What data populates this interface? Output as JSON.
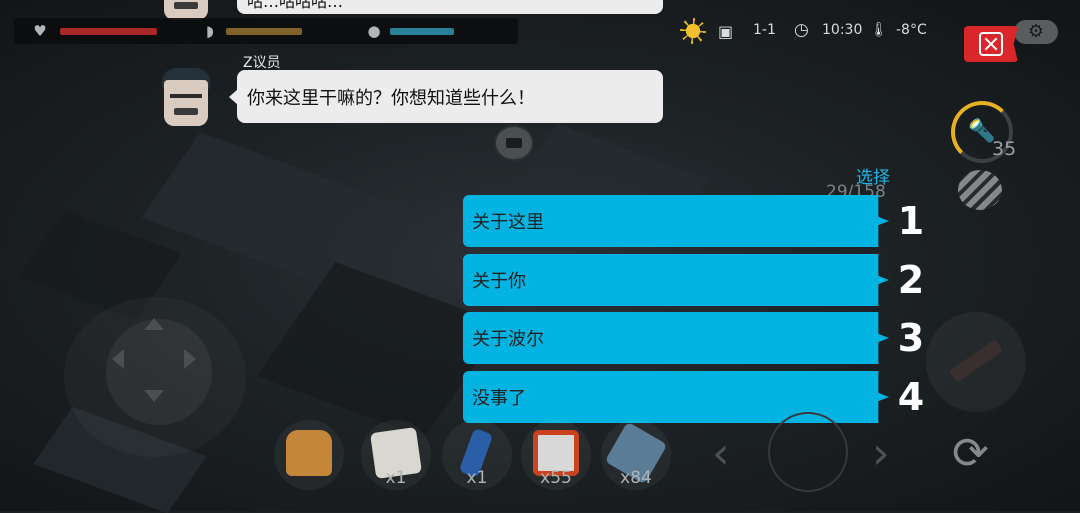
{
  "dialog": {
    "previous_text": "咕…咕咕咕…",
    "speaker": "Z议员",
    "message": "你来这里干嘛的？你想知道些什么！",
    "choose_label": "选择",
    "options": [
      {
        "label": "关于这里",
        "number": "1"
      },
      {
        "label": "关于你",
        "number": "2"
      },
      {
        "label": "关于波尔",
        "number": "3"
      },
      {
        "label": "没事了",
        "number": "4"
      }
    ]
  },
  "status": {
    "day": "1-1",
    "time": "10:30",
    "temperature": "-8°C",
    "health_level": 0.7,
    "hunger_level": 0.6,
    "thirst_level": 0.55
  },
  "right_hud": {
    "flashlight_count": "35",
    "ammo": "29/158"
  },
  "inventory": [
    {
      "name": "backpack",
      "qty": ""
    },
    {
      "name": "map",
      "qty": "x1"
    },
    {
      "name": "bottle",
      "qty": "x1"
    },
    {
      "name": "crate",
      "qty": "x55"
    },
    {
      "name": "cloth",
      "qty": "x84"
    }
  ],
  "colors": {
    "option_bg": "#03b4e2",
    "choose_label": "#1eb6e6",
    "close_button": "#d8262b",
    "health_bar": "#b52a2a",
    "hunger_bar": "#8a6a2a",
    "thirst_bar": "#2a8aa0"
  }
}
